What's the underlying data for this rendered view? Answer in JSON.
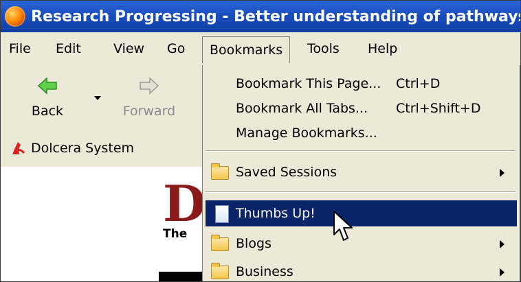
{
  "window": {
    "title": "Research Progressing - Better understanding of pathways c"
  },
  "menubar": {
    "items": [
      {
        "label": "File"
      },
      {
        "label": "Edit"
      },
      {
        "label": "View"
      },
      {
        "label": "Go"
      },
      {
        "label": "Bookmarks"
      },
      {
        "label": "Tools"
      },
      {
        "label": "Help"
      }
    ]
  },
  "toolbar": {
    "back_label": "Back",
    "forward_label": "Forward",
    "back_icon": "back-arrow-icon",
    "forward_icon": "forward-arrow-icon"
  },
  "bookmarks_toolbar": {
    "items": [
      {
        "label": "Dolcera System",
        "icon": "dolcera-icon"
      }
    ]
  },
  "page": {
    "logo_letter": "D",
    "logo_subtext": "The"
  },
  "bookmarks_menu": {
    "items": [
      {
        "label": "Bookmark This Page...",
        "shortcut": "Ctrl+D"
      },
      {
        "label": "Bookmark All Tabs...",
        "shortcut": "Ctrl+Shift+D"
      },
      {
        "label": "Manage Bookmarks..."
      },
      {
        "label": "Saved Sessions",
        "icon": "folder-icon",
        "submenu": true
      },
      {
        "label": "Thumbs Up!",
        "icon": "page-icon",
        "selected": true
      },
      {
        "label": "Blogs",
        "icon": "folder-icon",
        "submenu": true
      },
      {
        "label": "Business",
        "icon": "folder-icon",
        "submenu": true
      }
    ]
  },
  "colors": {
    "title_bar": "#1b4fbf",
    "menu_bg": "#ece9d8",
    "selection": "#0a246a"
  }
}
